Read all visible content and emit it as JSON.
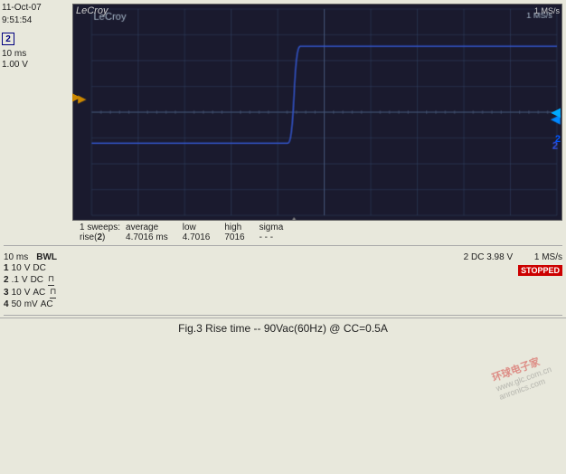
{
  "timestamp": {
    "date": "11-Oct-07",
    "time": "9:51:54"
  },
  "channel_info": {
    "ch2_num": "2",
    "timescale": "10 ms",
    "voltage": "1.00 V"
  },
  "scope": {
    "brand": "LeCroy",
    "ms_label": "1 MS/s"
  },
  "stats": {
    "label": "1 sweeps:",
    "cols": [
      "average",
      "low",
      "high",
      "sigma"
    ],
    "row_label": "rise(2)",
    "values": [
      "4.7016 ms",
      "4.7016",
      "7016",
      "---"
    ]
  },
  "settings": {
    "timebase": "10 ms",
    "bwl": "BWL",
    "ch1": {
      "num": "1",
      "voltage": "10",
      "unit": "V",
      "coupling": "DC"
    },
    "ch2": {
      "num": "2",
      "voltage": ".1",
      "unit": "V",
      "coupling": "DC"
    },
    "ch3": {
      "num": "3",
      "voltage": "10",
      "unit": "V",
      "coupling": "AC"
    },
    "ch4": {
      "num": "4",
      "voltage": "50",
      "unit": "mV",
      "coupling": "AC"
    },
    "ch2_display": "2 DC 3.98 V",
    "stopped": "STOPPED"
  },
  "caption": "Fig.3  Rise time  --  90Vac(60Hz) @  CC=0.5A",
  "watermark": "www.glc.com.cn",
  "site": "anronics.com"
}
